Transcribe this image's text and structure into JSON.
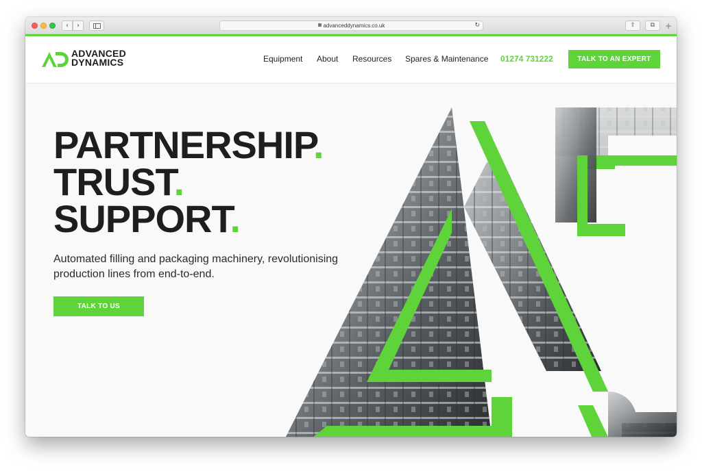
{
  "browser": {
    "url": "advanceddynamics.co.uk"
  },
  "header": {
    "logo_line1": "ADVANCED",
    "logo_line2": "DYNAMICS",
    "nav": [
      "Equipment",
      "About",
      "Resources",
      "Spares & Maintenance"
    ],
    "phone": "01274 731222",
    "cta": "TALK TO AN EXPERT"
  },
  "hero": {
    "headline": [
      "PARTNERSHIP",
      "TRUST",
      "SUPPORT"
    ],
    "headline_dot": ".",
    "subtitle": "Automated filling and packaging machinery, revolutionising production lines from end-to-end.",
    "cta": "TALK TO US"
  },
  "colors": {
    "accent": "#5fd33a",
    "text": "#1e1e1e"
  }
}
